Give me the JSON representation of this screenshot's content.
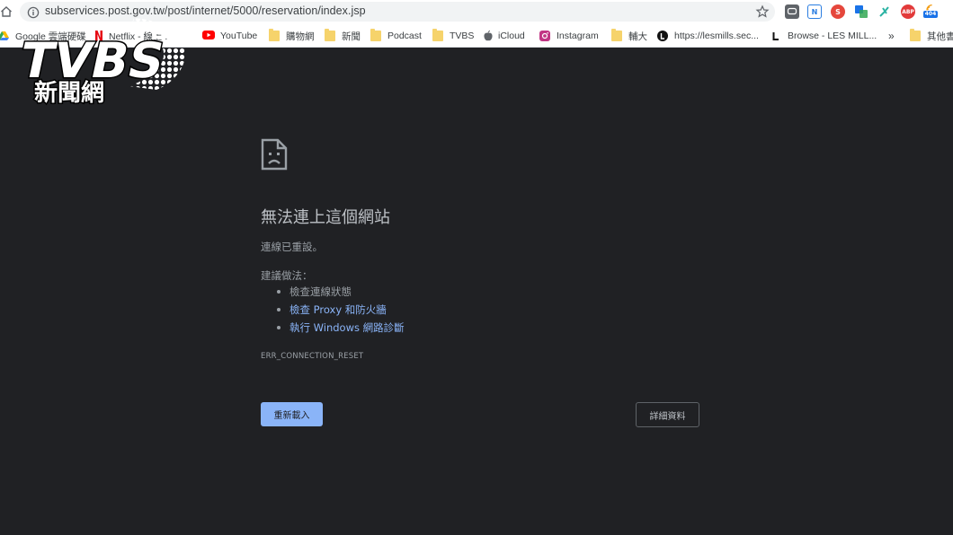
{
  "browser": {
    "url": "subservices.post.gov.tw/post/internet/5000/reservation/index.jsp",
    "extensions": [
      {
        "name": "line",
        "text": "",
        "color": "#5f6368"
      },
      {
        "name": "notion",
        "text": "N",
        "color": "#2a7de1"
      },
      {
        "name": "s-ext",
        "text": "S",
        "color": "#e5473c"
      },
      {
        "name": "translate",
        "text": "",
        "color": "#1a73e8"
      },
      {
        "name": "tool",
        "text": "",
        "color": "#2bb3a3"
      },
      {
        "name": "abp",
        "text": "ABP",
        "color": "#e23a3a"
      },
      {
        "name": "rss",
        "text": "",
        "color": "#f39c12"
      }
    ],
    "ext_badge": "404",
    "bookmarks": [
      {
        "label": "Google 雲端硬碟",
        "icon": "google-drive-icon"
      },
      {
        "label": "Netflix - 線上...",
        "icon": "netflix-icon"
      },
      {
        "label": "YouTube",
        "icon": "youtube-icon"
      },
      {
        "label": "購物網",
        "icon": "folder-icon"
      },
      {
        "label": "新聞",
        "icon": "folder-icon"
      },
      {
        "label": "Podcast",
        "icon": "folder-icon"
      },
      {
        "label": "TVBS",
        "icon": "folder-icon"
      },
      {
        "label": "iCloud",
        "icon": "apple-icon"
      },
      {
        "label": "Instagram",
        "icon": "instagram-icon"
      },
      {
        "label": "輔大",
        "icon": "folder-icon"
      },
      {
        "label": "https://lesmills.sec...",
        "icon": "lesmills-icon"
      },
      {
        "label": "Browse - LES MILL...",
        "icon": "lesmills-icon"
      }
    ],
    "bookmarks_overflow": "»",
    "other_bookmarks": "其他書籤"
  },
  "watermark": {
    "brand": "TVBS",
    "subtitle": "新聞網"
  },
  "error_page": {
    "heading": "無法連上這個網站",
    "message": "連線已重設。",
    "suggestions_title": "建議做法：",
    "suggestions": [
      {
        "text": "檢查連線狀態",
        "link": false
      },
      {
        "text": "檢查 Proxy 和防火牆",
        "link": true
      },
      {
        "text": "執行 Windows 網路診斷",
        "link": true
      }
    ],
    "error_code": "ERR_CONNECTION_RESET",
    "reload_label": "重新載入",
    "details_label": "詳細資料"
  }
}
